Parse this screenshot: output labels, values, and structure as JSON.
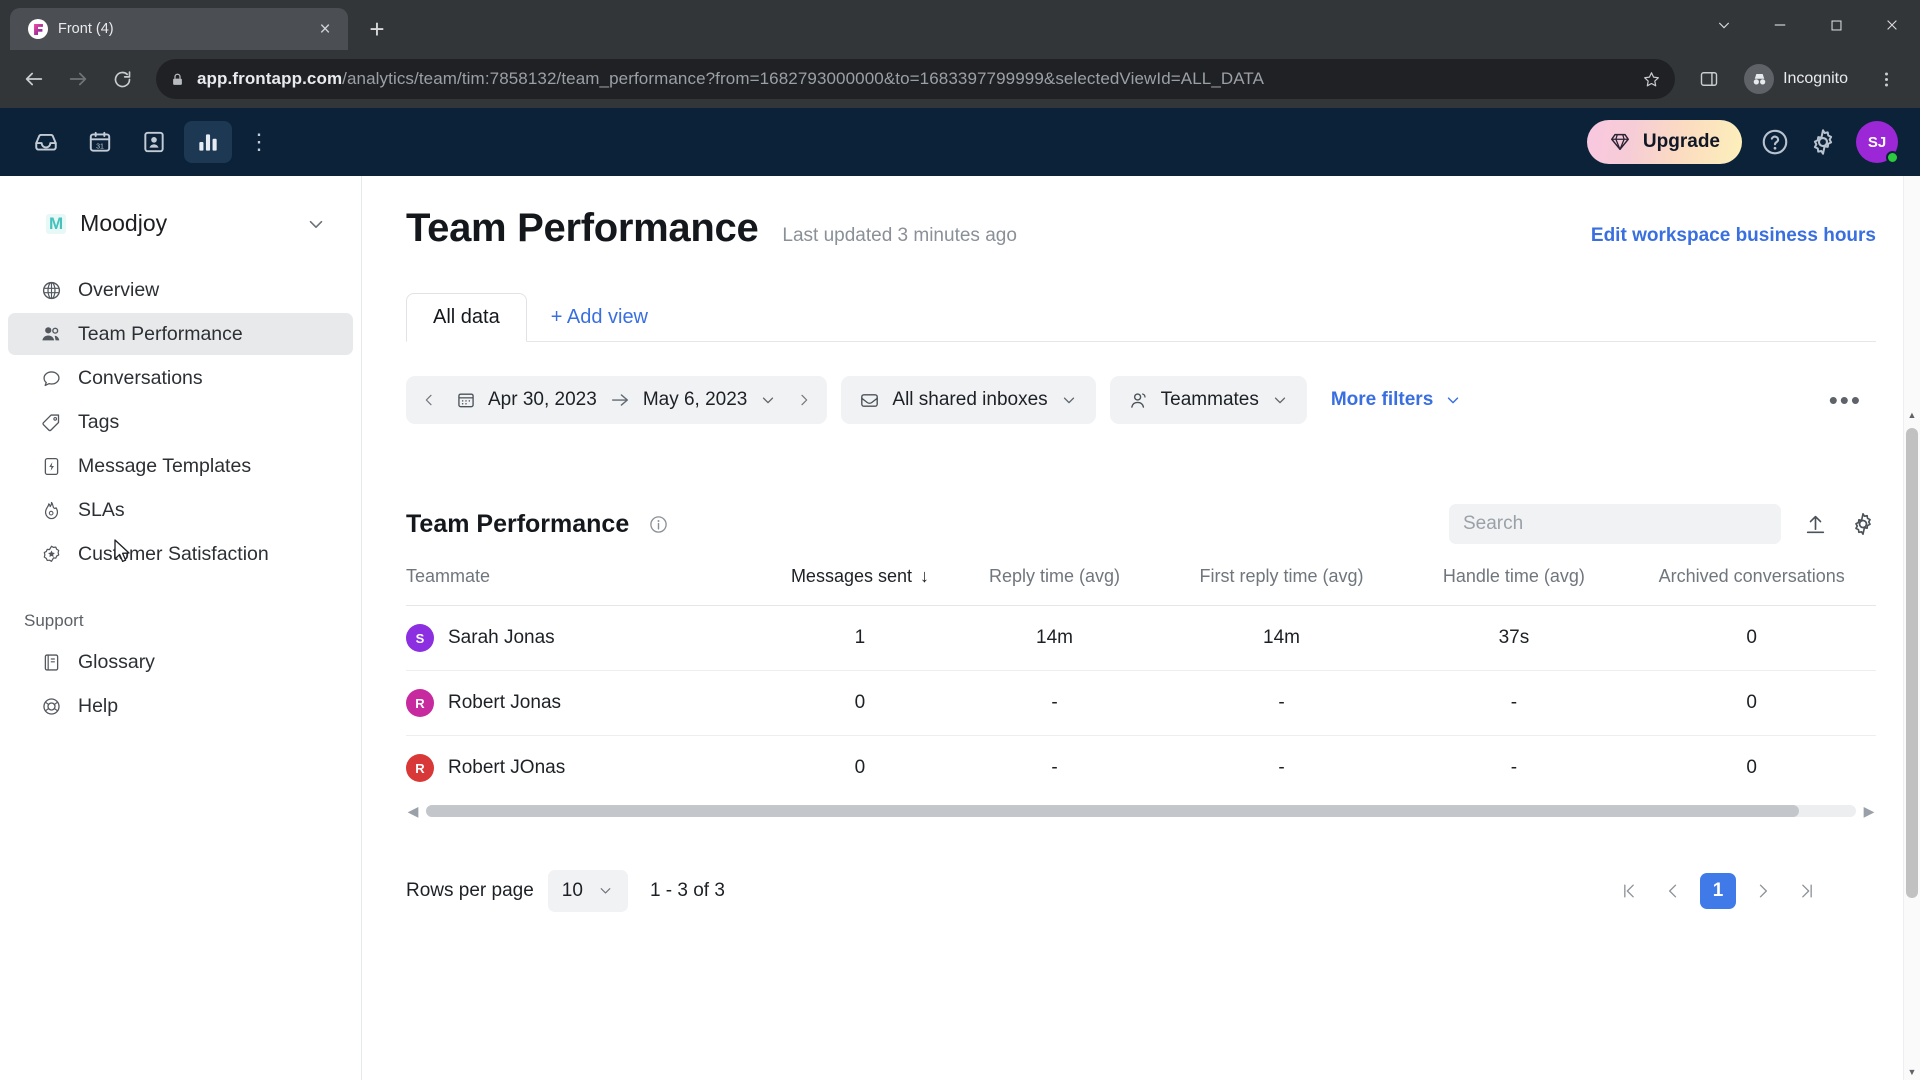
{
  "browser": {
    "tab": {
      "title": "Front (4)",
      "favicon": "front-logo-icon",
      "close": "×"
    },
    "new_tab": "+",
    "url_host": "app.frontapp.com",
    "url_path": "/analytics/team/tim:7858132/team_performance?from=1682793000000&to=1683397799999&selectedViewId=ALL_DATA",
    "profile_label": "Incognito",
    "icons": {
      "back": "back-arrow-icon",
      "forward": "forward-arrow-icon",
      "reload": "reload-icon",
      "lock": "lock-icon",
      "bookmark": "star-icon",
      "side_panel": "side-panel-icon",
      "menu": "chrome-menu-icon",
      "minimize": "minimize-icon",
      "maximize": "maximize-icon",
      "close": "window-close-icon",
      "collapse": "chevron-down-icon"
    }
  },
  "app_top": {
    "nav": [
      {
        "name": "inbox",
        "icon": "inbox-icon",
        "active": false
      },
      {
        "name": "calendar",
        "icon": "calendar-31-icon",
        "active": false
      },
      {
        "name": "contacts",
        "icon": "contact-card-icon",
        "active": false
      },
      {
        "name": "analytics",
        "icon": "bar-chart-icon",
        "active": true
      }
    ],
    "more": "⋮",
    "upgrade_label": "Upgrade",
    "upgrade_icon": "gem-icon",
    "help_icon": "question-circle-icon",
    "settings_icon": "gear-icon",
    "avatar_initials": "SJ",
    "avatar_color": "#9b27d6",
    "presence_color": "#2dca3f"
  },
  "sidebar": {
    "workspace": {
      "badge": "M",
      "name": "Moodjoy",
      "chevron": "chevron-down-icon"
    },
    "items": [
      {
        "label": "Overview",
        "icon": "globe-icon",
        "active": false
      },
      {
        "label": "Team Performance",
        "icon": "people-icon",
        "active": true
      },
      {
        "label": "Conversations",
        "icon": "speech-bubble-icon",
        "active": false
      },
      {
        "label": "Tags",
        "icon": "tag-icon",
        "active": false
      },
      {
        "label": "Message Templates",
        "icon": "lightning-template-icon",
        "active": false
      },
      {
        "label": "SLAs",
        "icon": "flame-icon",
        "active": false
      },
      {
        "label": "Customer Satisfaction",
        "icon": "star-badge-icon",
        "active": false
      }
    ],
    "support_label": "Support",
    "support_items": [
      {
        "label": "Glossary",
        "icon": "book-icon"
      },
      {
        "label": "Help",
        "icon": "lifebuoy-icon"
      }
    ]
  },
  "main": {
    "title": "Team Performance",
    "last_updated": "Last updated 3 minutes ago",
    "edit_business_hours": "Edit workspace business hours",
    "tabs": [
      {
        "label": "All data",
        "active": true
      }
    ],
    "add_view": "+ Add view",
    "filters": {
      "date_from": "Apr 30, 2023",
      "date_to": "May 6, 2023",
      "prev_arrow": "chevron-left-icon",
      "next_arrow": "chevron-right-icon",
      "range_arrow": "arrow-right-icon",
      "calendar_icon": "calendar-icon",
      "inboxes_label": "All shared inboxes",
      "inboxes_icon": "inbox-outline-icon",
      "teammates_label": "Teammates",
      "teammates_icon": "person-outline-icon",
      "more_filters_label": "More filters",
      "overflow": "•••"
    }
  },
  "table": {
    "title": "Team Performance",
    "info_icon": "info-icon",
    "search_placeholder": "Search",
    "search_value": "",
    "export_icon": "upload-icon",
    "settings_icon": "gear-icon",
    "columns": [
      "Teammate",
      "Messages sent",
      "Reply time (avg)",
      "First reply time (avg)",
      "Handle time (avg)",
      "Archived conversations"
    ],
    "sorted_column": "Messages sent",
    "sort_direction": "↓",
    "rows": [
      {
        "name": "Sarah Jonas",
        "initial": "S",
        "avatar_color": "#8b2fe0",
        "messages_sent": "1",
        "reply_time": "14m",
        "first_reply_time": "14m",
        "handle_time": "37s",
        "archived": "0"
      },
      {
        "name": "Robert Jonas",
        "initial": "R",
        "avatar_color": "#c62a9e",
        "messages_sent": "0",
        "reply_time": "-",
        "first_reply_time": "-",
        "handle_time": "-",
        "archived": "0"
      },
      {
        "name": "Robert JOnas",
        "initial": "R",
        "avatar_color": "#d93838",
        "messages_sent": "0",
        "reply_time": "-",
        "first_reply_time": "-",
        "handle_time": "-",
        "archived": "0"
      }
    ]
  },
  "pagination": {
    "rows_per_page_label": "Rows per page",
    "rows_per_page_value": "10",
    "range_label": "1 - 3 of 3",
    "current_page": "1",
    "first_icon": "first-page-icon",
    "prev_icon": "prev-page-icon",
    "next_icon": "next-page-icon",
    "last_icon": "last-page-icon"
  },
  "colors": {
    "accent_blue": "#3a6fe0",
    "app_navy": "#0b2239",
    "sidebar_active": "#e8e9eb"
  }
}
